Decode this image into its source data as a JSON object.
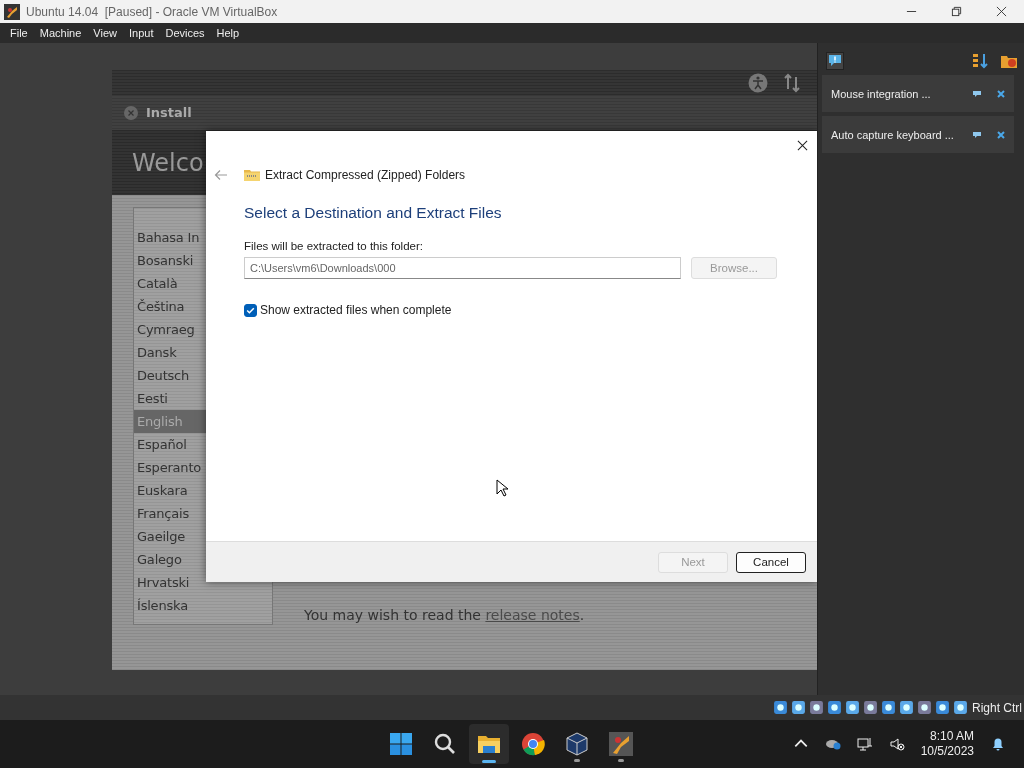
{
  "window": {
    "title": "Ubuntu 14.04  [Paused] - Oracle VM VirtualBox"
  },
  "menu": [
    "File",
    "Machine",
    "View",
    "Input",
    "Devices",
    "Help"
  ],
  "installer": {
    "title": "Install",
    "heading": "Welco",
    "languages": [
      {
        "label": "Bahasa In",
        "selected": false
      },
      {
        "label": "Bosanski",
        "selected": false
      },
      {
        "label": "Català",
        "selected": false
      },
      {
        "label": "Čeština",
        "selected": false
      },
      {
        "label": "Cymraeg",
        "selected": false
      },
      {
        "label": "Dansk",
        "selected": false
      },
      {
        "label": "Deutsch",
        "selected": false
      },
      {
        "label": "Eesti",
        "selected": false
      },
      {
        "label": "English",
        "selected": true
      },
      {
        "label": "Español",
        "selected": false
      },
      {
        "label": "Esperanto",
        "selected": false
      },
      {
        "label": "Euskara",
        "selected": false
      },
      {
        "label": "Français",
        "selected": false
      },
      {
        "label": "Gaeilge",
        "selected": false
      },
      {
        "label": "Galego",
        "selected": false
      },
      {
        "label": "Hrvatski",
        "selected": false
      },
      {
        "label": "Íslenska",
        "selected": false
      }
    ],
    "note": {
      "text": "You may wish to read the ",
      "link": "release notes",
      "end": "."
    }
  },
  "dialog": {
    "title": "Extract Compressed (Zipped) Folders",
    "heading": "Select a Destination and Extract Files",
    "field_label": "Files will be extracted to this folder:",
    "path": "C:\\Users\\vm6\\Downloads\\000",
    "browse": {
      "label": "Browse...",
      "disabled": true
    },
    "show_files": {
      "label": "Show extracted files when complete",
      "checked": true
    },
    "buttons": [
      {
        "label": "Next",
        "disabled": true,
        "default": false
      },
      {
        "label": "Cancel",
        "disabled": false,
        "default": true
      }
    ]
  },
  "notifications": [
    {
      "text": "Mouse integration ..."
    },
    {
      "text": "Auto capture keyboard ..."
    }
  ],
  "status_bar": {
    "host_key": "Right Ctrl"
  },
  "taskbar": {
    "apps": [
      {
        "kind": "start",
        "selected": false
      },
      {
        "kind": "search",
        "selected": false
      },
      {
        "kind": "files",
        "selected": true
      },
      {
        "kind": "browser",
        "selected": false
      },
      {
        "kind": "vbox",
        "selected": false
      },
      {
        "kind": "app",
        "selected": false
      }
    ],
    "time": "8:10 AM",
    "date": "10/5/2023"
  }
}
